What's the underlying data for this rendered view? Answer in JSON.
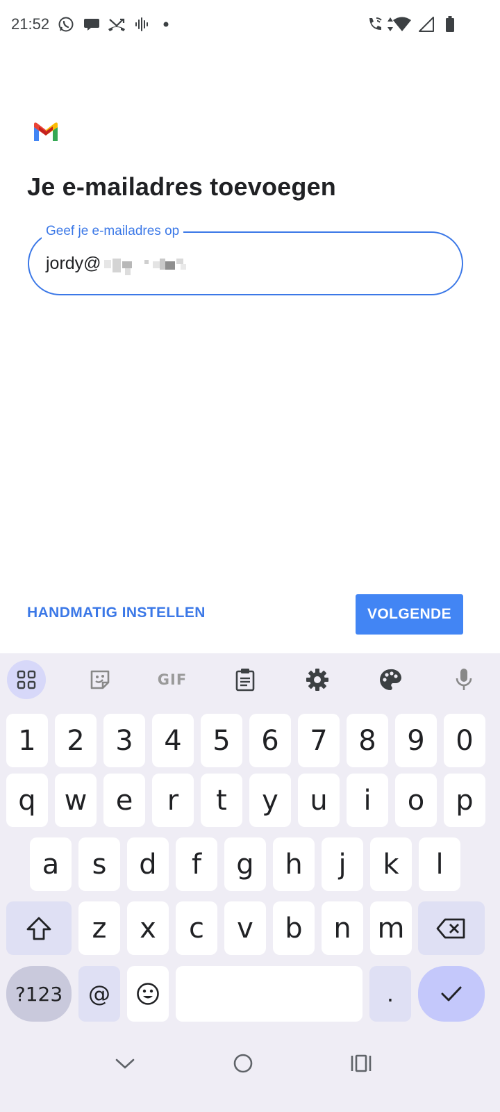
{
  "status_bar": {
    "time": "21:52",
    "left_icons": [
      "whatsapp-icon",
      "messages-icon",
      "missed-call-icon",
      "voice-recorder-icon",
      "notification-dot-icon"
    ],
    "right_icons": [
      "wifi-call-icon",
      "data-arrows-icon",
      "wifi-icon",
      "cell-signal-icon",
      "battery-icon"
    ]
  },
  "app": {
    "logo": "gmail-logo",
    "title": "Je e-mailadres toevoegen",
    "email_field": {
      "label": "Geef je e-mailadres op",
      "value": "jordy@"
    },
    "manual_setup_label": "HANDMATIG INSTELLEN",
    "next_label": "VOLGENDE",
    "colors": {
      "accent": "#3b78e7",
      "button": "#4285f4"
    }
  },
  "keyboard": {
    "toolbar": [
      "apps-grid-icon",
      "sticker-icon",
      "gif-icon",
      "clipboard-icon",
      "settings-gear-icon",
      "palette-icon",
      "microphone-icon"
    ],
    "gif_label": "GIF",
    "row_numbers": [
      "1",
      "2",
      "3",
      "4",
      "5",
      "6",
      "7",
      "8",
      "9",
      "0"
    ],
    "row1": [
      "q",
      "w",
      "e",
      "r",
      "t",
      "y",
      "u",
      "i",
      "o",
      "p"
    ],
    "row2": [
      "a",
      "s",
      "d",
      "f",
      "g",
      "h",
      "j",
      "k",
      "l"
    ],
    "row3": [
      "z",
      "x",
      "c",
      "v",
      "b",
      "n",
      "m"
    ],
    "symbols_label": "?123",
    "at_label": "@",
    "period_label": "."
  },
  "nav_bar": [
    "back-chevron-icon",
    "home-circle-icon",
    "recents-icon"
  ]
}
